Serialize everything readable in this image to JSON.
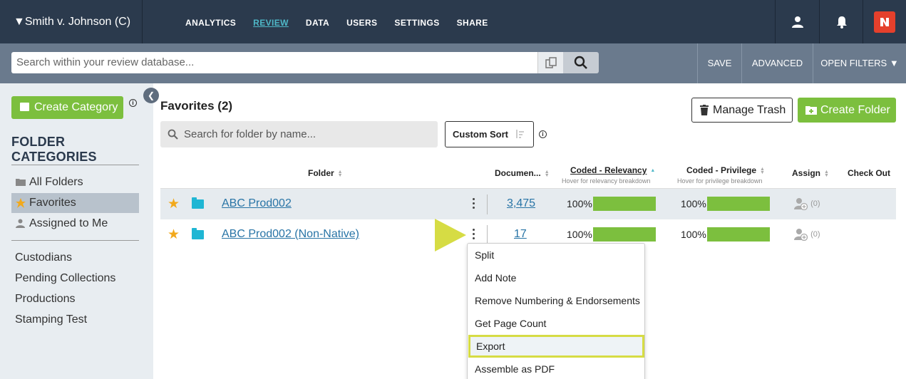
{
  "case": {
    "title": "▼Smith v. Johnson (C)"
  },
  "nav": {
    "items": [
      "ANALYTICS",
      "REVIEW",
      "DATA",
      "USERS",
      "SETTINGS",
      "SHARE"
    ],
    "active": "REVIEW"
  },
  "top_icons": [
    "user-icon",
    "bell-icon",
    "logo-icon"
  ],
  "search": {
    "placeholder": "Search within your review database...",
    "save": "SAVE",
    "advanced": "ADVANCED",
    "open_filters": "OPEN FILTERS ▼"
  },
  "sidebar": {
    "create_category": "Create Category",
    "heading": "FOLDER CATEGORIES",
    "items": [
      {
        "label": "All Folders",
        "icon": "folder-icon"
      },
      {
        "label": "Favorites",
        "icon": "star-icon",
        "active": true
      },
      {
        "label": "Assigned to Me",
        "icon": "person-icon"
      }
    ],
    "links": [
      "Custodians",
      "Pending Collections",
      "Productions",
      "Stamping Test"
    ]
  },
  "main": {
    "title": "Favorites (2)",
    "manage_trash": "Manage Trash",
    "create_folder": "Create Folder",
    "folder_search_placeholder": "Search for folder by name...",
    "custom_sort": "Custom Sort",
    "columns": {
      "folder": "Folder",
      "documents": "Documen...",
      "relevancy": "Coded - Relevancy",
      "relevancy_sub": "Hover for relevancy breakdown",
      "privilege": "Coded - Privilege",
      "privilege_sub": "Hover for privilege breakdown",
      "assign": "Assign",
      "checkout": "Check Out"
    },
    "rows": [
      {
        "name": "ABC Prod002",
        "docs": "3,475",
        "relevancy": "100%",
        "privilege": "100%",
        "assign": "(0)"
      },
      {
        "name": "ABC Prod002 (Non-Native)",
        "docs": "17",
        "relevancy": "100%",
        "privilege": "100%",
        "assign": "(0)"
      }
    ]
  },
  "menu": {
    "items": [
      "Split",
      "Add Note",
      "Remove Numbering & Endorsements",
      "Get Page Count",
      "Export",
      "Assemble as PDF"
    ],
    "selected": "Export"
  },
  "colors": {
    "nav_bg": "#2b3a4d",
    "accent_green": "#7cbf3e",
    "highlight_yellow": "#d6dc44",
    "link_blue": "#2874a6",
    "folder_cyan": "#1fb6d4",
    "star_orange": "#f2a91c",
    "logo_red": "#e5402c"
  }
}
